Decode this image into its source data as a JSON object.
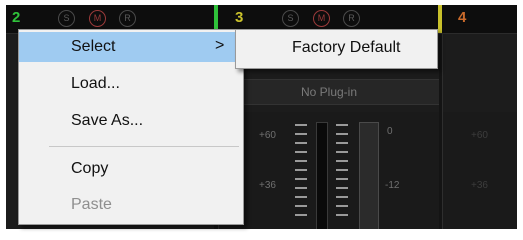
{
  "channels": {
    "ch2": {
      "number": "2",
      "color": "#2fc13a"
    },
    "ch3": {
      "number": "3",
      "color": "#c9c12b"
    },
    "ch4": {
      "number": "4",
      "color": "#c96a2b"
    },
    "buttons": {
      "solo": "S",
      "mute": "M",
      "record": "R"
    }
  },
  "plugin_slot": {
    "label": "No Plug-in"
  },
  "meter_scale": {
    "fader_top": "+60",
    "fader_mid": "+36",
    "level_top": "0",
    "level_mid": "-12"
  },
  "context_menu": {
    "items": [
      {
        "label": "Select",
        "highlighted": true,
        "has_submenu": true,
        "arrow": ">"
      },
      {
        "label": "Load..."
      },
      {
        "label": "Save As..."
      },
      {
        "label": "Copy"
      },
      {
        "label": "Paste",
        "disabled": true
      }
    ]
  },
  "submenu": {
    "items": [
      {
        "label": "Factory Default"
      }
    ]
  },
  "colors": {
    "menu_bg": "#f1f1f1",
    "highlight": "#9fcbf1",
    "mixer_bg": "#141414"
  }
}
